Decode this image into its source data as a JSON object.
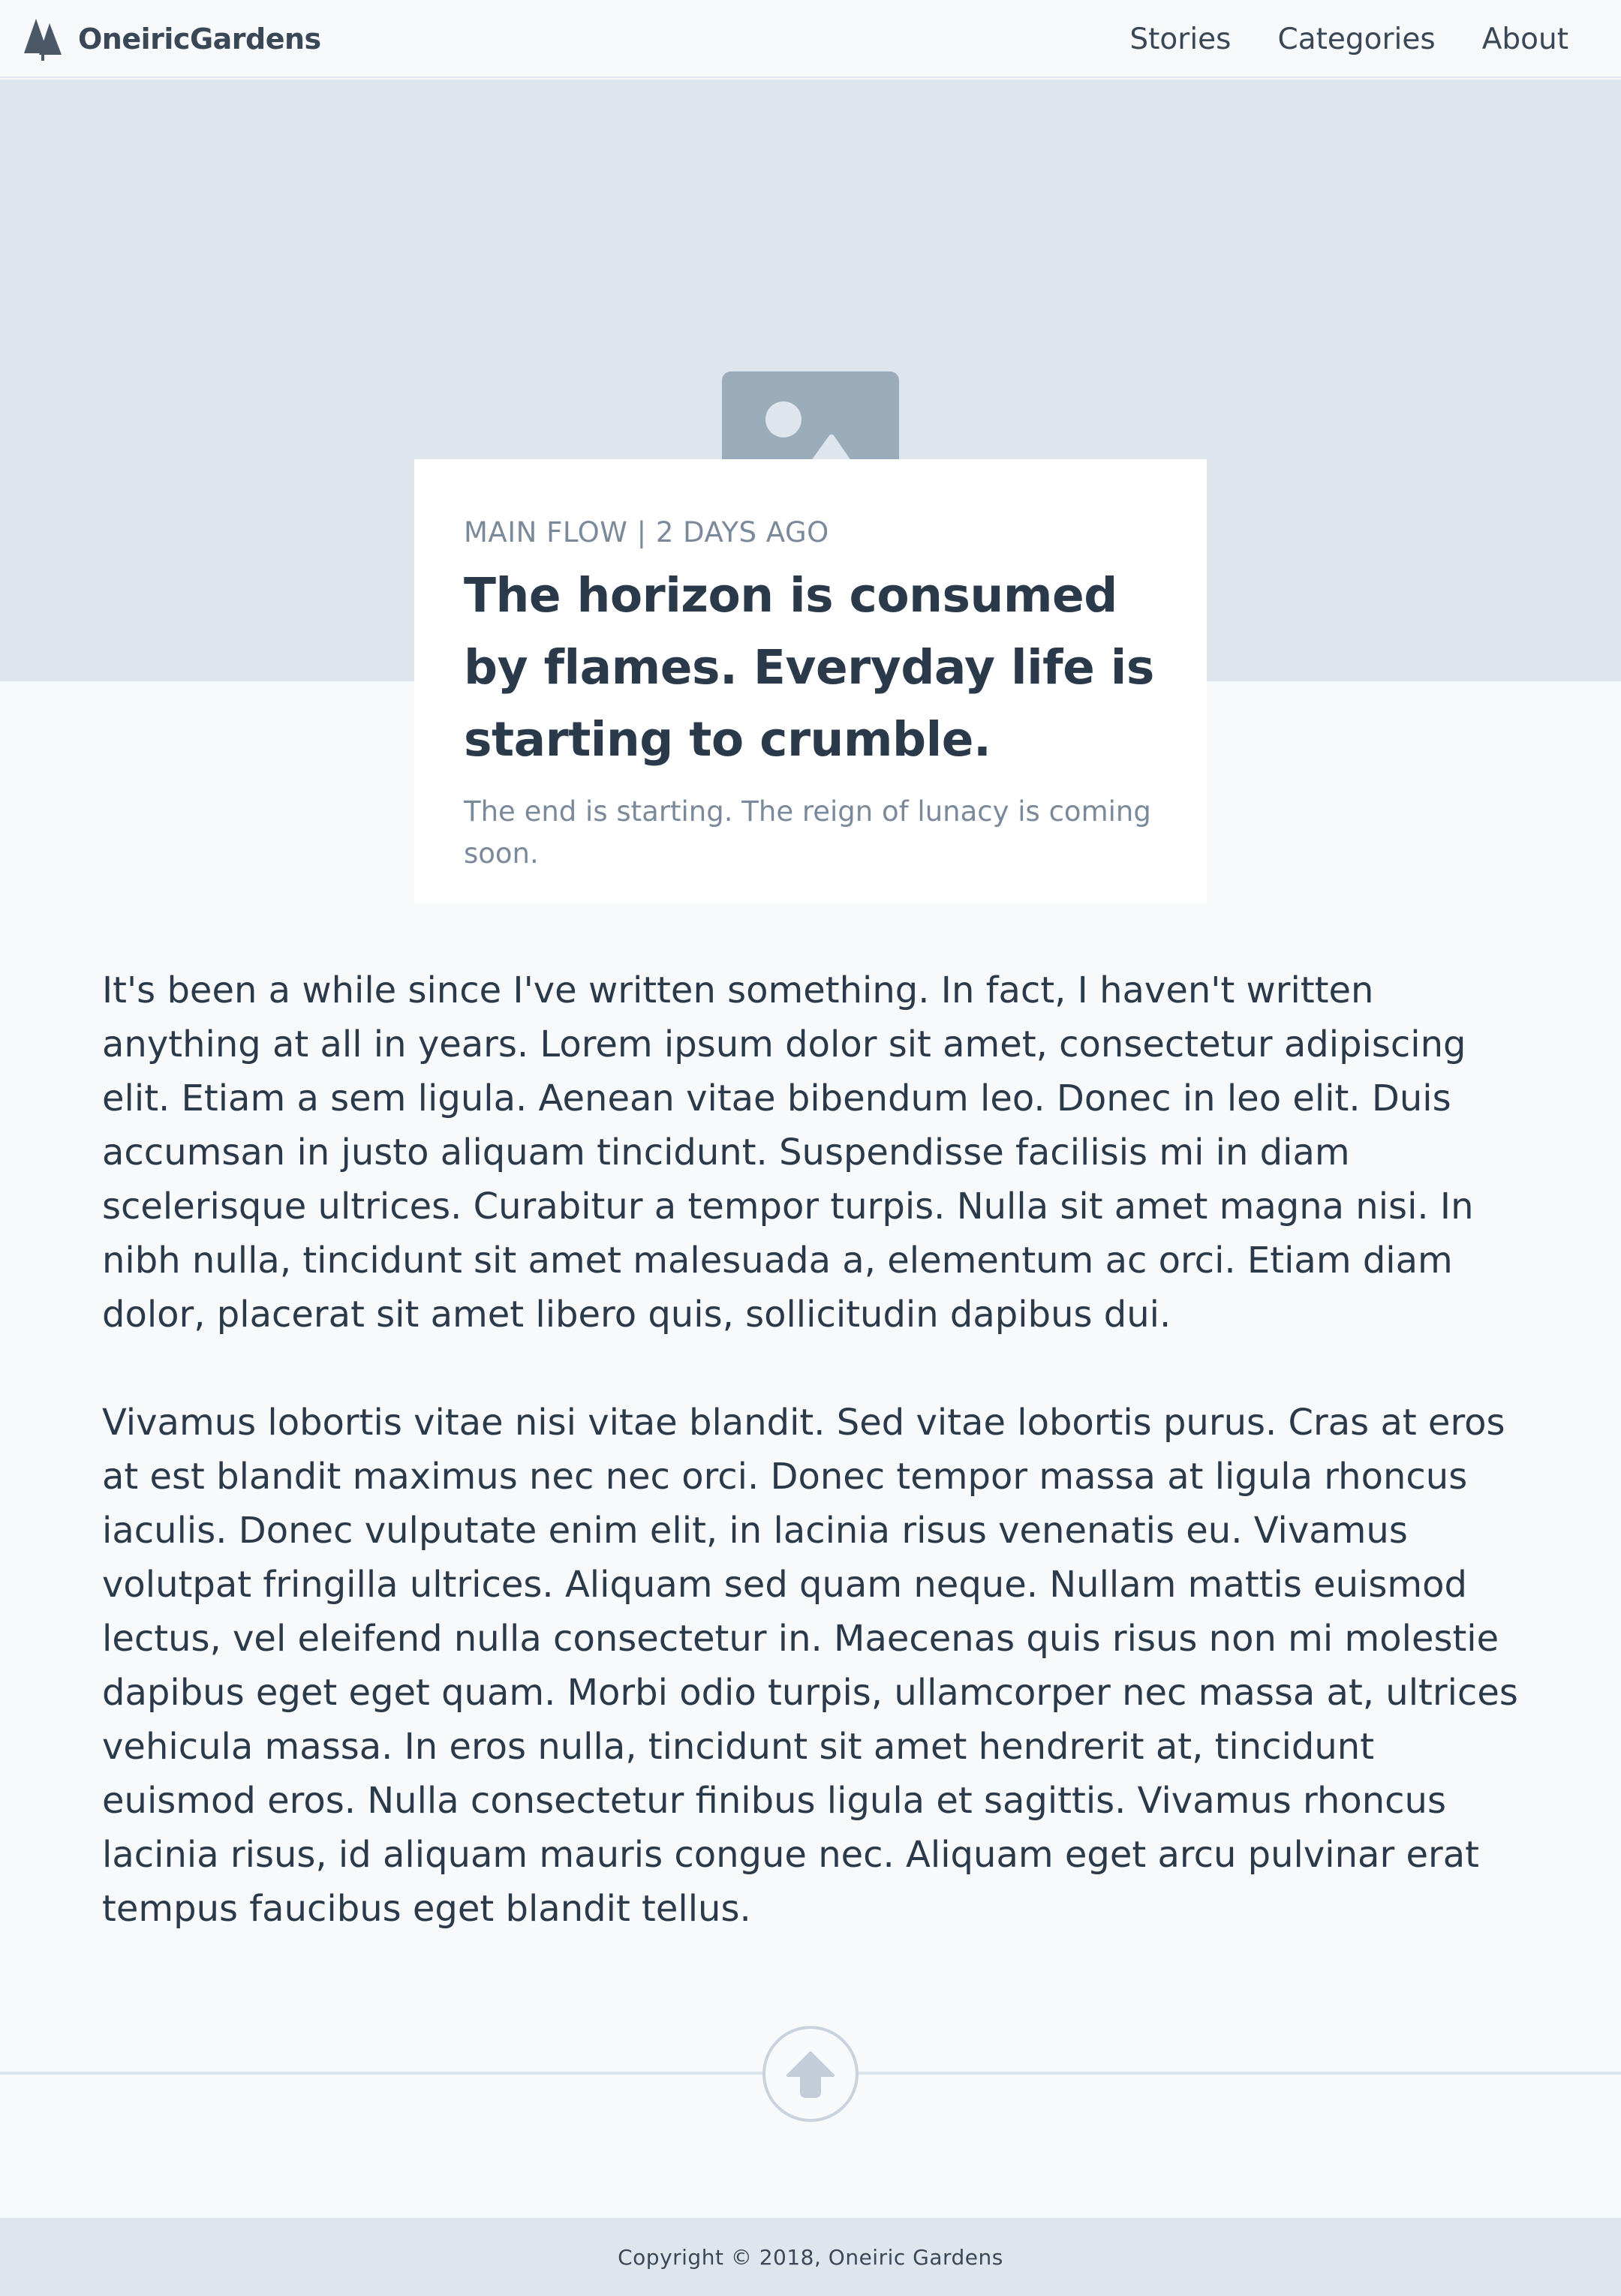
{
  "nav": {
    "brand": "OneiricGardens",
    "logo_icon": "pine-trees-icon",
    "links": [
      "Stories",
      "Categories",
      "About"
    ]
  },
  "hero": {
    "image_icon": "image-placeholder-icon",
    "background_color": "#dfe5ed"
  },
  "card": {
    "meta": "MAIN FLOW | 2 DAYS AGO",
    "title": "The horizon is consumed by flames. Everyday life is starting to crumble.",
    "subtitle": "The end is starting. The reign of lunacy is coming soon."
  },
  "article": {
    "paragraphs": [
      "It's been a while since I've written something. In fact, I haven't written anything at all in years. Lorem ipsum dolor sit amet, consectetur adipiscing elit. Etiam a sem ligula. Aenean vitae bibendum leo. Donec in leo elit. Duis accumsan in justo aliquam tincidunt. Suspendisse facilisis mi in diam scelerisque ultrices. Curabitur a tempor turpis. Nulla sit amet magna nisi. In nibh nulla, tincidunt sit amet malesuada a, elementum ac orci. Etiam diam dolor, placerat sit amet libero quis, sollicitudin dapibus dui.",
      "Vivamus lobortis vitae nisi vitae blandit. Sed vitae lobortis purus. Cras at eros at est blandit maximus nec nec orci. Donec tempor massa at ligula rhoncus iaculis. Donec vulputate enim elit, in lacinia risus venenatis eu. Vivamus volutpat fringilla ultrices. Aliquam sed quam neque. Nullam mattis euismod lectus, vel eleifend nulla consectetur in. Maecenas quis risus non mi molestie dapibus eget eget quam. Morbi odio turpis, ullamcorper nec massa at, ultrices vehicula massa. In eros nulla, tincidunt sit amet hendrerit at, tincidunt euismod eros. Nulla consectetur finibus ligula et sagittis. Vivamus rhoncus lacinia risus, id aliquam mauris congue nec. Aliquam eget arcu pulvinar erat tempus faucibus eget blandit tellus."
    ]
  },
  "back_to_top": {
    "icon": "arrow-up-icon"
  },
  "footer": {
    "copyright": "Copyright © 2018, Oneiric Gardens"
  }
}
